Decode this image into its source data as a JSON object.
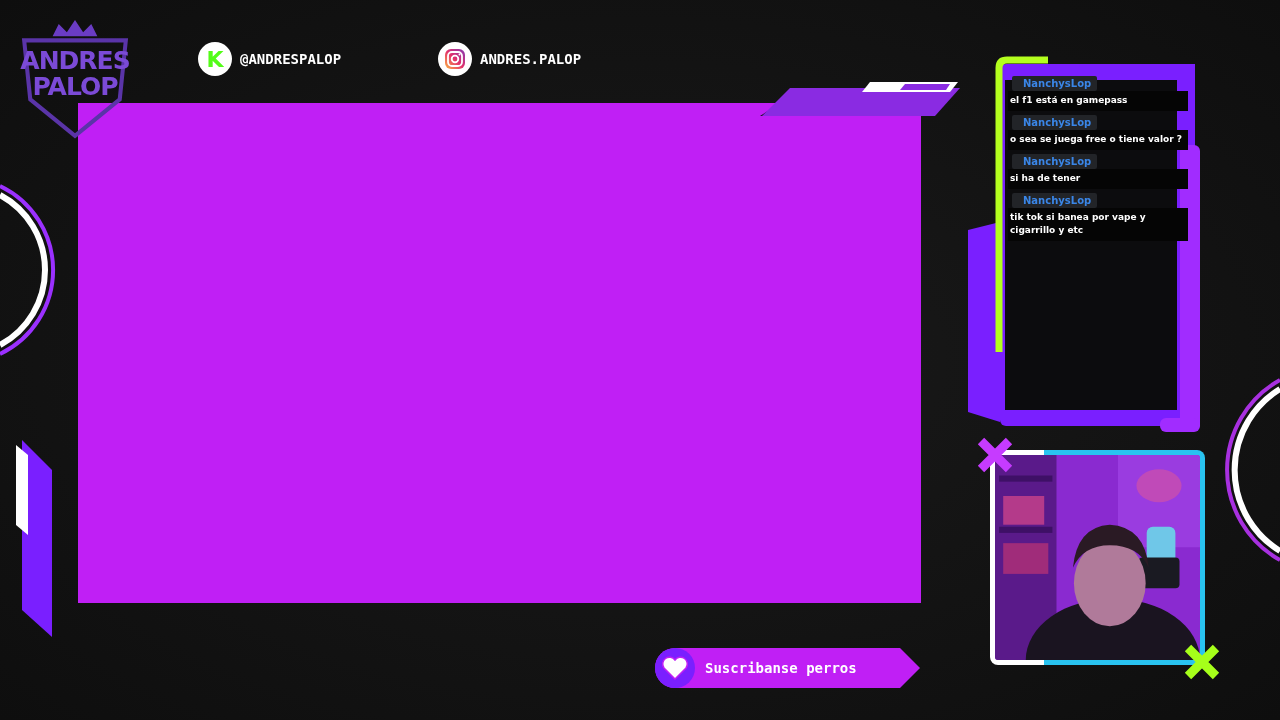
{
  "logo": {
    "lines": [
      "ANDRES",
      "PALOP"
    ]
  },
  "socials": [
    {
      "kind": "kick",
      "glyph": "K",
      "handle": "@ANDRESPALOP"
    },
    {
      "kind": "instagram",
      "handle": "ANDRES.PALOP"
    }
  ],
  "chat": {
    "messages": [
      {
        "user": "NanchysLop",
        "text": "el f1 está en gamepass"
      },
      {
        "user": "NanchysLop",
        "text": "o sea se juega free o tiene valor ?"
      },
      {
        "user": "NanchysLop",
        "text": "si ha de tener"
      },
      {
        "user": "NanchysLop",
        "text": "tik tok si banea por vape y cigarrillo y etc"
      }
    ]
  },
  "subscribe": {
    "label": "Suscribanse perros"
  }
}
